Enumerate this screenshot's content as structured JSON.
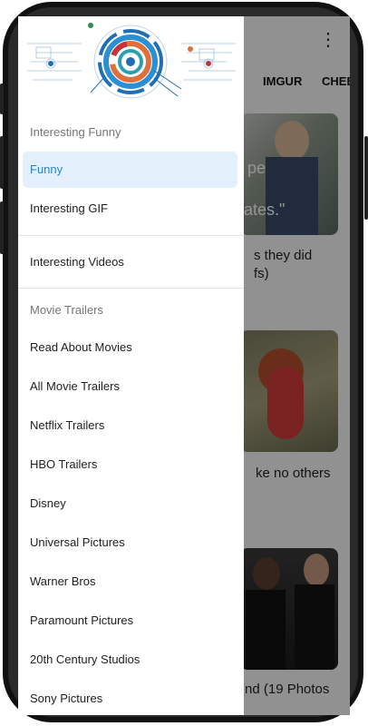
{
  "app": {
    "tabs": [
      "IMGUR",
      "CHEE"
    ],
    "captions": [
      {
        "lines": [
          "s they did",
          "fs)"
        ]
      },
      {
        "lines": [
          "ke no others"
        ]
      },
      {
        "lines": [
          "nd (19 Photos"
        ]
      }
    ],
    "image_text": [
      "pe",
      "ates.\""
    ]
  },
  "drawer": {
    "sections": {
      "interesting": "Interesting Funny",
      "movie": "Movie Trailers"
    },
    "items_top": [
      "Funny",
      "Interesting GIF"
    ],
    "item_videos": "Interesting Videos",
    "items_movie": [
      "Read About Movies",
      "All Movie Trailers",
      "Netflix Trailers",
      "HBO Trailers",
      "Disney",
      "Universal Pictures",
      "Warner Bros",
      "Paramount Pictures",
      "20th Century Studios",
      "Sony Pictures"
    ],
    "selected": "Funny",
    "accent": "#1f86d1"
  }
}
